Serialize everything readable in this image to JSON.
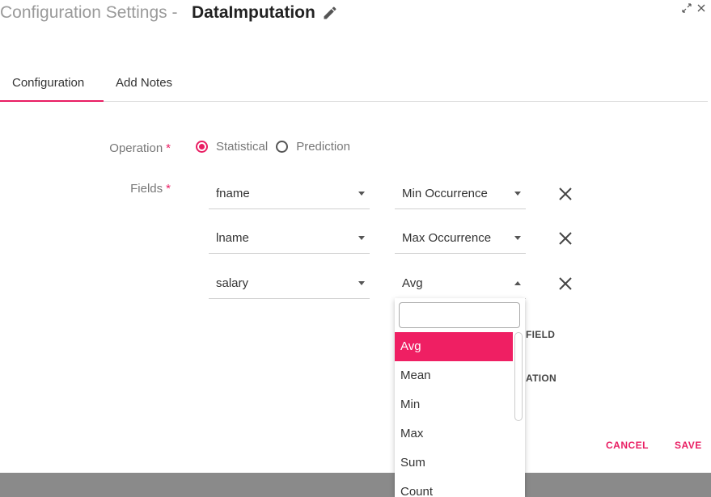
{
  "header": {
    "prefix": "Configuration Settings - ",
    "name": "DataImputation"
  },
  "tabs": [
    {
      "label": "Configuration",
      "active": true
    },
    {
      "label": "Add Notes",
      "active": false
    }
  ],
  "form": {
    "operation_label": "Operation",
    "fields_label": "Fields",
    "required_mark": "*",
    "radios": [
      {
        "label": "Statistical",
        "checked": true
      },
      {
        "label": "Prediction",
        "checked": false
      }
    ],
    "rows": [
      {
        "field": "fname",
        "operation": "Min Occurrence"
      },
      {
        "field": "lname",
        "operation": "Max Occurrence"
      },
      {
        "field": "salary",
        "operation": "Avg"
      }
    ]
  },
  "hidden_text": {
    "line1": "FIELD",
    "line2": "ATION"
  },
  "actions": {
    "cancel": "CANCEL",
    "save": "SAVE"
  },
  "dropdown": {
    "search_value": "",
    "options": [
      "Avg",
      "Mean",
      "Min",
      "Max",
      "Sum",
      "Count"
    ],
    "selected": "Avg"
  },
  "colors": {
    "accent": "#e91e63"
  }
}
